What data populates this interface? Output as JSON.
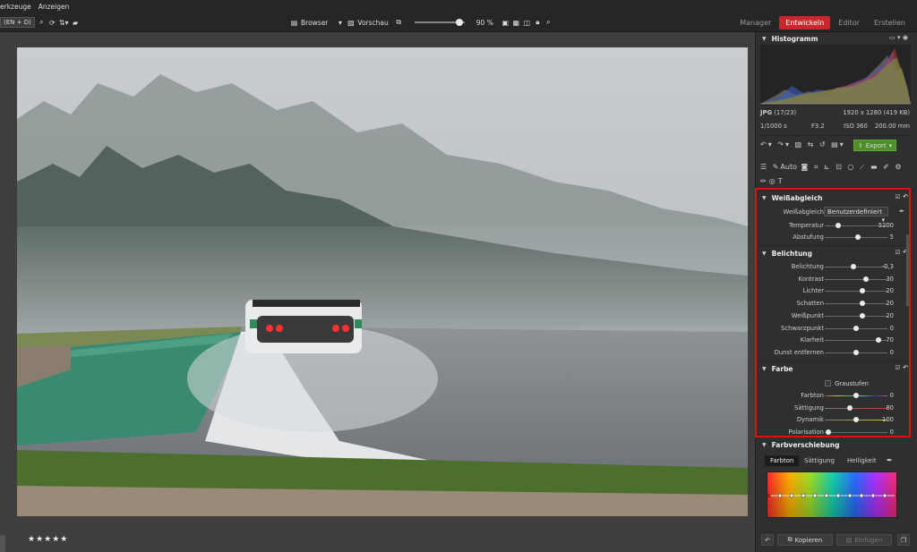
{
  "menu": [
    "erkzeuge",
    "Anzeigen"
  ],
  "toolbar": {
    "language_combo": "(EN + D)",
    "browser_label": "Browser",
    "preview_label": "Vorschau",
    "zoom_value": 90,
    "zoom_label": "90 %"
  },
  "modes": [
    {
      "label": "Manager",
      "active": false
    },
    {
      "label": "Entwickeln",
      "active": true
    },
    {
      "label": "Editor",
      "active": false
    },
    {
      "label": "Erstellen",
      "active": false
    }
  ],
  "histogram": {
    "title": "Histogramm",
    "format": "JPG",
    "index": "(17/23)",
    "dimensions": "1920 x 1280 (419 KB)",
    "shutter": "1/1000 s",
    "aperture": "F3.2",
    "iso": "ISO 360",
    "focal": "200.00 mm"
  },
  "tools": {
    "export_label": "Export",
    "auto_label": "Auto"
  },
  "white_balance": {
    "title": "Weißabgleich",
    "mode_label": "Weißabgleich",
    "mode_value": "Benutzerdefiniert",
    "sliders": [
      {
        "label": "Temperatur",
        "value": "5200",
        "pos": 0.22
      },
      {
        "label": "Abstufung",
        "value": "5",
        "pos": 0.53
      }
    ]
  },
  "exposure": {
    "title": "Belichtung",
    "sliders": [
      {
        "label": "Belichtung",
        "value": "-0,3",
        "pos": 0.45
      },
      {
        "label": "Kontrast",
        "value": "30",
        "pos": 0.65
      },
      {
        "label": "Lichter",
        "value": "20",
        "pos": 0.6
      },
      {
        "label": "Schatten",
        "value": "20",
        "pos": 0.6
      },
      {
        "label": "Weißpunkt",
        "value": "20",
        "pos": 0.6
      },
      {
        "label": "Schwarzpunkt",
        "value": "0",
        "pos": 0.5
      },
      {
        "label": "Klarheit",
        "value": "70",
        "pos": 0.85
      },
      {
        "label": "Dunst entfernen",
        "value": "0",
        "pos": 0.5
      }
    ]
  },
  "color": {
    "title": "Farbe",
    "grayscale_label": "Graustufen",
    "sliders": [
      {
        "label": "Farbton",
        "value": "0",
        "pos": 0.5
      },
      {
        "label": "Sättigung",
        "value": "80",
        "pos": 0.4
      },
      {
        "label": "Dynamik",
        "value": "100",
        "pos": 0.5
      },
      {
        "label": "Polarisation",
        "value": "0",
        "pos": 0.05
      }
    ]
  },
  "color_shift": {
    "title": "Farbverschiebung",
    "tabs": [
      {
        "label": "Farbton",
        "active": true
      },
      {
        "label": "Sättigung",
        "active": false
      },
      {
        "label": "Helligkeit",
        "active": false
      }
    ]
  },
  "bottom": {
    "copy_label": "Kopieren",
    "paste_label": "Einfügen"
  },
  "rating": "★★★★★"
}
